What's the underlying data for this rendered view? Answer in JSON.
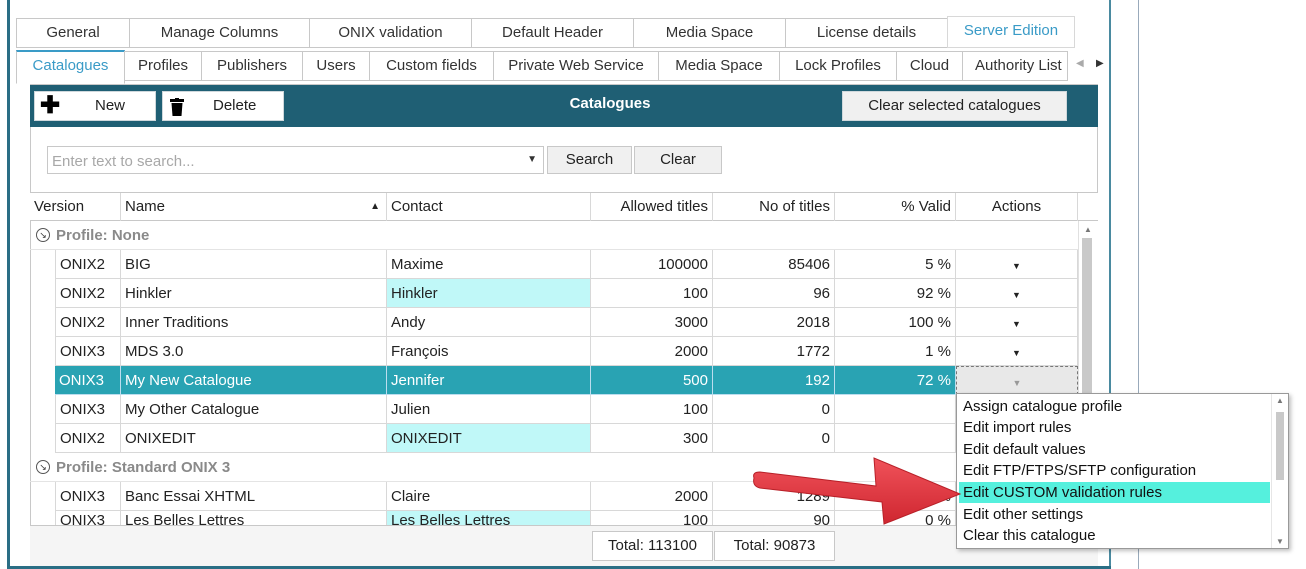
{
  "top_tabs": [
    {
      "label": "General"
    },
    {
      "label": "Manage Columns"
    },
    {
      "label": "ONIX validation"
    },
    {
      "label": "Default Header"
    },
    {
      "label": "Media Space"
    },
    {
      "label": "License details"
    },
    {
      "label": "Server Edition"
    }
  ],
  "sub_tabs": [
    {
      "label": "Catalogues"
    },
    {
      "label": "Profiles"
    },
    {
      "label": "Publishers"
    },
    {
      "label": "Users"
    },
    {
      "label": "Custom fields"
    },
    {
      "label": "Private Web Service"
    },
    {
      "label": "Media Space"
    },
    {
      "label": "Lock Profiles"
    },
    {
      "label": "Cloud"
    },
    {
      "label": "Authority List"
    }
  ],
  "toolbar": {
    "new_label": "New",
    "delete_label": "Delete",
    "title": "Catalogues",
    "clear_selected_label": "Clear selected catalogues"
  },
  "search": {
    "placeholder": "Enter text to search...",
    "value": "",
    "search_label": "Search",
    "clear_label": "Clear"
  },
  "columns": [
    "Version",
    "Name",
    "Contact",
    "Allowed titles",
    "No of titles",
    "% Valid",
    "Actions"
  ],
  "groups": [
    {
      "label": "Profile: None"
    },
    {
      "label": "Profile: Standard ONIX 3"
    }
  ],
  "rows": [
    {
      "version": "ONIX2",
      "name": "BIG",
      "contact": "Maxime",
      "allowed": "100000",
      "count": "85406",
      "valid": "5 %"
    },
    {
      "version": "ONIX2",
      "name": "Hinkler",
      "contact": "Hinkler",
      "allowed": "100",
      "count": "96",
      "valid": "92 %"
    },
    {
      "version": "ONIX2",
      "name": "Inner Traditions",
      "contact": "Andy",
      "allowed": "3000",
      "count": "2018",
      "valid": "100 %"
    },
    {
      "version": "ONIX3",
      "name": "MDS 3.0",
      "contact": "François",
      "allowed": "2000",
      "count": "1772",
      "valid": "1 %"
    },
    {
      "version": "ONIX3",
      "name": "My New Catalogue",
      "contact": "Jennifer",
      "allowed": "500",
      "count": "192",
      "valid": "72 %"
    },
    {
      "version": "ONIX3",
      "name": "My Other Catalogue",
      "contact": "Julien",
      "allowed": "100",
      "count": "0",
      "valid": ""
    },
    {
      "version": "ONIX2",
      "name": "ONIXEDIT",
      "contact": "ONIXEDIT",
      "allowed": "300",
      "count": "0",
      "valid": ""
    },
    {
      "version": "ONIX3",
      "name": "Banc Essai XHTML",
      "contact": "Claire",
      "allowed": "2000",
      "count": "1289",
      "valid": "% "
    },
    {
      "version": "ONIX3",
      "name": "Les Belles Lettres",
      "contact": "Les Belles Lettres",
      "allowed": "100",
      "count": "90",
      "valid": "0 %"
    }
  ],
  "footer": {
    "total_allowed": "Total: 113100",
    "total_count": "Total: 90873"
  },
  "actions_menu": [
    "Assign catalogue profile",
    "Edit import rules",
    "Edit default values",
    "Edit FTP/FTPS/SFTP configuration",
    "Edit CUSTOM validation rules",
    "Edit other settings",
    "Clear this catalogue"
  ],
  "icons": {
    "new": "plus-icon",
    "delete": "trash-icon",
    "dropdown": "chevron-down-icon",
    "sort": "sort-up-icon"
  },
  "colors": {
    "toolbar": "#1f5f74",
    "selected_row": "#29a3b3",
    "highlight_cell": "#c0f8f8",
    "menu_highlight": "#55f0dd",
    "arrow": "#e8393f",
    "tab_active": "#3a9bc7"
  }
}
